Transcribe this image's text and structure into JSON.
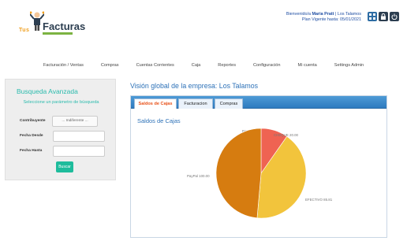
{
  "logo": {
    "tus": "Tus",
    "facturas": "Facturas"
  },
  "header": {
    "greeting": "Bienvenido/a",
    "user": "Maria Pratt",
    "company": "Los Talamos",
    "plan_label": "Plan Vigente hasta:",
    "plan_date": "05/01/2021",
    "icons": [
      "apps-icon",
      "lock-icon",
      "power-icon"
    ]
  },
  "nav": [
    "Facturación / Ventas",
    "Compras",
    "Cuentas Corrientes",
    "Caja",
    "Reportes",
    "Configuración",
    "Mi cuenta",
    "Settings Admin"
  ],
  "search": {
    "title": "Busqueda Avanzada",
    "hint": "Seleccione un parámetro de búsqueda",
    "contribuyente_label": "Contribuyente",
    "contribuyente_value": "... Indiferente ...",
    "fecha_desde_label": "Fecha Desde",
    "fecha_hasta_label": "Fecha Hasta",
    "buscar_label": "Buscar"
  },
  "main": {
    "title": "Visión global de la empresa: Los Talamos",
    "tabs": [
      "Saldos de Cajas",
      "Facturacion",
      "Compras"
    ],
    "section_title": "Saldos de Cajas"
  },
  "chart_data": {
    "type": "pie",
    "title": "Saldos de Cajas",
    "slices": [
      {
        "label": "Banco",
        "value": 0.0,
        "display": "Banco 0.00",
        "color": "#f26b7a"
      },
      {
        "label": "CHEQUE",
        "value": 20.0,
        "display": "CHEQUE 20.00",
        "color": "#ef6352"
      },
      {
        "label": "EFECTIVO",
        "value": 85.81,
        "display": "EFECTIVO 85.81",
        "color": "#f2c43c"
      },
      {
        "label": "PayPal",
        "value": 100.0,
        "display": "PayPal 100.00",
        "color": "#d67c10"
      }
    ]
  }
}
